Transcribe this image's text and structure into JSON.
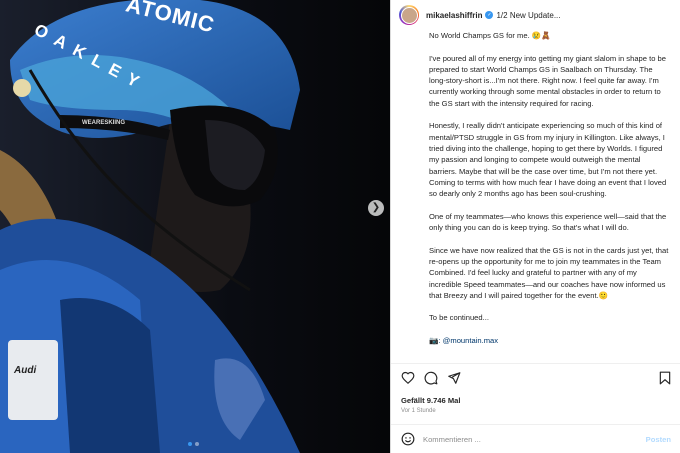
{
  "photo": {
    "helmet_brand": "ATOMIC",
    "helmet_text": "OAKLEY",
    "strap_text": "WEARESKIING",
    "bib_logo": "Audi",
    "next_icon": "chevron-right-icon",
    "slides_total": 2,
    "slide_active": 1
  },
  "post": {
    "username": "mikaelashiffrin",
    "verified_icon": "verified-badge-icon",
    "update_text": "1/2 New Update...",
    "caption_paragraphs": [
      "No World Champs GS for me. 😢🧸",
      "I've poured all of my energy into getting my giant slalom in shape to be prepared to start World Champs GS in Saalbach on Thursday. The long-story-short is...I'm not there. Right now. I feel quite far away. I'm currently working through some mental obstacles in order to return to the GS start with the intensity required for racing.",
      "Honestly, I really didn't anticipate experiencing so much of this kind of mental/PTSD struggle in GS from my injury in Killington. Like always, I tried diving into the challenge, hoping to get there by Worlds. I figured my passion and longing to compete would outweigh the mental barriers. Maybe that will be the case over time, but I'm not there yet. Coming to terms with how much fear I have doing an event that I loved so dearly only 2 months ago has been soul-crushing.",
      "One of my teammates—who knows this experience well—said that the only thing you can do is keep trying. So that's what I will do.",
      "Since we have now realized that the GS is not in the cards just yet, that re-opens up the opportunity for me to join my teammates in the Team Combined. I'd feel lucky and grateful to partner with any of my incredible Speed teammates—and our coaches have now informed us that Breezy and I will paired together for the event.🙂",
      "To be continued..."
    ],
    "mention": "📷: @mountain.max",
    "likes": "Gefällt 9.746 Mal",
    "time_ago": "Vor 1 Stunde"
  },
  "actions": {
    "like_icon": "heart-icon",
    "comment_icon": "comment-icon",
    "share_icon": "share-icon",
    "save_icon": "bookmark-icon"
  },
  "comment": {
    "emoji_icon": "emoji-icon",
    "placeholder": "Kommentieren ...",
    "post_label": "Posten"
  }
}
